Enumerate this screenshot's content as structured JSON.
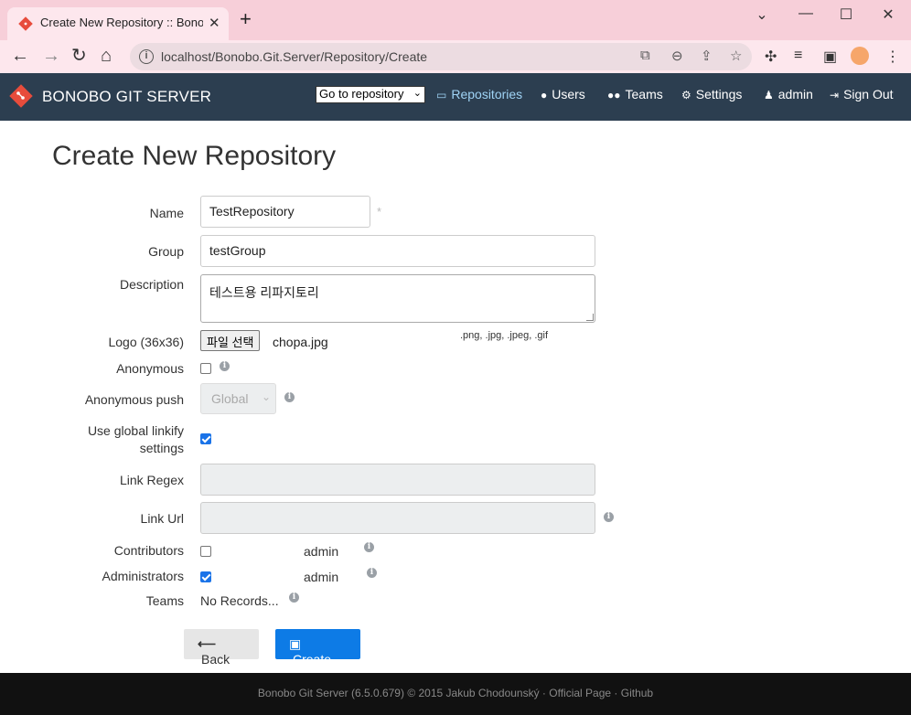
{
  "browser": {
    "tab_title": "Create New Repository :: Bonobo Git Server",
    "url": "localhost/Bonobo.Git.Server/Repository/Create"
  },
  "navbar": {
    "brand": "BONOBO GIT SERVER",
    "repo_select": "Go to repository",
    "items": [
      {
        "label": "Repositories",
        "icon": "hdd-icon"
      },
      {
        "label": "Users",
        "icon": "user-icon"
      },
      {
        "label": "Teams",
        "icon": "users-icon"
      },
      {
        "label": "Settings",
        "icon": "gears-icon"
      },
      {
        "label": "admin",
        "icon": "person-icon"
      },
      {
        "label": "Sign Out",
        "icon": "sign-out-icon"
      }
    ]
  },
  "page": {
    "title": "Create New Repository"
  },
  "form": {
    "name": {
      "label": "Name",
      "value": "TestRepository",
      "required_mark": "*"
    },
    "group": {
      "label": "Group",
      "value": "testGroup"
    },
    "description": {
      "label": "Description",
      "value": "테스트용 리파지토리"
    },
    "logo": {
      "label": "Logo (36x36)",
      "button": "파일 선택",
      "file": "chopa.jpg",
      "hint": ".png, .jpg, .jpeg, .gif"
    },
    "anonymous": {
      "label": "Anonymous",
      "checked": false
    },
    "anonymous_push": {
      "label": "Anonymous push",
      "value": "Global",
      "disabled": true
    },
    "global_linkify": {
      "label_line1": "Use global linkify",
      "label_line2": "settings",
      "checked": true
    },
    "link_regex": {
      "label": "Link Regex",
      "value": ""
    },
    "link_url": {
      "label": "Link Url",
      "value": ""
    },
    "contributors": {
      "label": "Contributors",
      "user": "admin",
      "checked": false
    },
    "administrators": {
      "label": "Administrators",
      "user": "admin",
      "checked": true
    },
    "teams": {
      "label": "Teams",
      "value": "No Records..."
    }
  },
  "buttons": {
    "back": "Back",
    "create": "Create"
  },
  "footer": {
    "text": "Bonobo Git Server (6.5.0.679) © 2015 Jakub Chodounský · Official Page · Github"
  },
  "colors": {
    "navbar": "#2c3e50",
    "primary": "#0d7be6",
    "brand_red": "#e74c3c",
    "footer": "#111111"
  }
}
